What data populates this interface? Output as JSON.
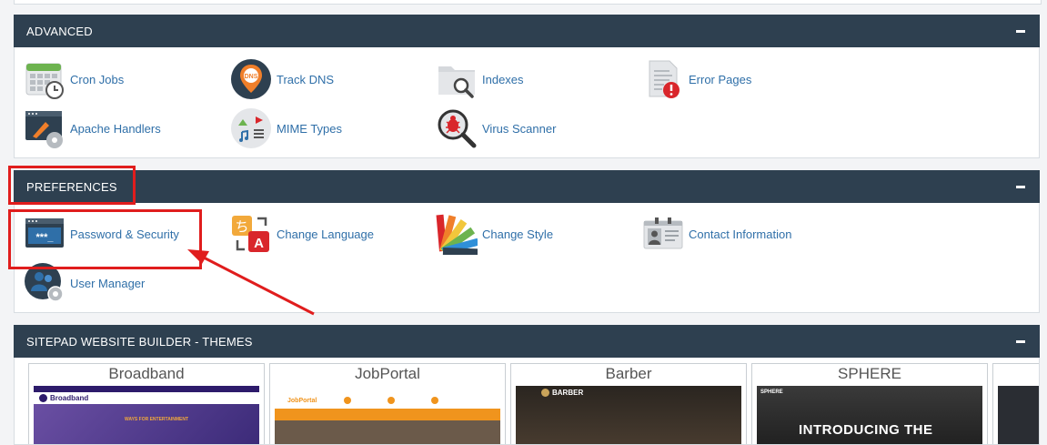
{
  "sections": {
    "advanced": {
      "title": "ADVANCED",
      "items": [
        {
          "label": "Cron Jobs",
          "icon": "calendar-clock-icon"
        },
        {
          "label": "Track DNS",
          "icon": "dns-pin-icon"
        },
        {
          "label": "Indexes",
          "icon": "folder-search-icon"
        },
        {
          "label": "Error Pages",
          "icon": "error-page-icon"
        },
        {
          "label": "Apache Handlers",
          "icon": "apache-handler-icon"
        },
        {
          "label": "MIME Types",
          "icon": "mime-media-icon"
        },
        {
          "label": "Virus Scanner",
          "icon": "virus-scan-icon"
        }
      ]
    },
    "preferences": {
      "title": "PREFERENCES",
      "items": [
        {
          "label": "Password & Security",
          "icon": "password-window-icon"
        },
        {
          "label": "Change Language",
          "icon": "language-icon"
        },
        {
          "label": "Change Style",
          "icon": "color-swatch-icon"
        },
        {
          "label": "Contact Information",
          "icon": "contact-card-icon"
        },
        {
          "label": "User Manager",
          "icon": "user-gear-icon"
        }
      ]
    },
    "sitepad": {
      "title": "SITEPAD WEBSITE BUILDER - THEMES",
      "themes": [
        {
          "name": "Broadband",
          "logo": "Broadband",
          "banner": "WAYS FOR ENTERTAINMENT"
        },
        {
          "name": "JobPortal",
          "logo": "JobPortal"
        },
        {
          "name": "Barber",
          "logo": "BARBER"
        },
        {
          "name": "SPHERE",
          "logo": "SPHERE",
          "headline": "INTRODUCING THE"
        }
      ]
    }
  },
  "colors": {
    "header_bg": "#2e4050",
    "link": "#2f6fa8",
    "annotation": "#e01d1d"
  }
}
